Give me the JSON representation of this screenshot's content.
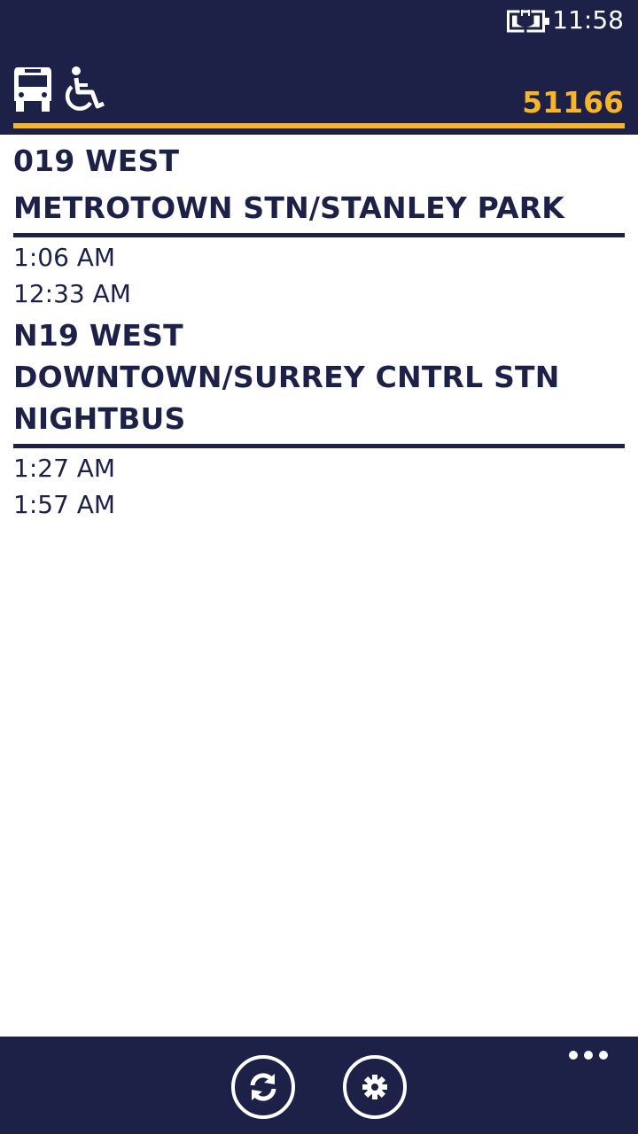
{
  "status_bar": {
    "time": "11:58",
    "battery_icon": "battery-charging-icon"
  },
  "header": {
    "bus_icon": "bus-icon",
    "accessibility_icon": "wheelchair-icon",
    "stop_number": "51166"
  },
  "routes": [
    {
      "lines": [
        "019 WEST",
        "METROTOWN STN/STANLEY PARK"
      ],
      "times": [
        "1:06 AM",
        "12:33 AM"
      ]
    },
    {
      "lines": [
        "N19 WEST",
        "DOWNTOWN/SURREY CNTRL STN",
        "NIGHTBUS"
      ],
      "times": [
        "1:27 AM",
        "1:57 AM"
      ]
    }
  ],
  "app_bar": {
    "refresh_icon": "refresh-icon",
    "settings_icon": "gear-icon",
    "more_icon": "more-dots-icon"
  },
  "colors": {
    "brand_navy": "#1e2147",
    "accent_gold": "#f7b52c",
    "background": "#ffffff"
  }
}
